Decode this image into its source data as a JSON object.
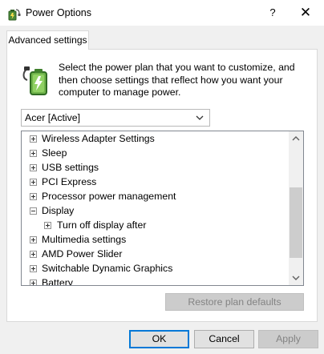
{
  "window": {
    "title": "Power Options",
    "help_glyph": "?",
    "close_glyph": "✕"
  },
  "tabs": [
    {
      "label": "Advanced settings",
      "active": true
    }
  ],
  "description": "Select the power plan that you want to customize, and then choose settings that reflect how you want your computer to manage power.",
  "plan_select": {
    "value": "Acer [Active]"
  },
  "tree": {
    "items": [
      {
        "label": "Wireless Adapter Settings",
        "expander": "plus",
        "level": 0
      },
      {
        "label": "Sleep",
        "expander": "plus",
        "level": 0
      },
      {
        "label": "USB settings",
        "expander": "plus",
        "level": 0
      },
      {
        "label": "PCI Express",
        "expander": "plus",
        "level": 0
      },
      {
        "label": "Processor power management",
        "expander": "plus",
        "level": 0
      },
      {
        "label": "Display",
        "expander": "minus",
        "level": 0
      },
      {
        "label": "Turn off display after",
        "expander": "plus",
        "level": 1
      },
      {
        "label": "Multimedia settings",
        "expander": "plus",
        "level": 0
      },
      {
        "label": "AMD Power Slider",
        "expander": "plus",
        "level": 0
      },
      {
        "label": "Switchable Dynamic Graphics",
        "expander": "plus",
        "level": 0
      },
      {
        "label": "Battery",
        "expander": "plus",
        "level": 0
      }
    ]
  },
  "buttons": {
    "restore": {
      "label": "Restore plan defaults",
      "enabled": false
    },
    "ok": {
      "label": "OK",
      "enabled": true
    },
    "cancel": {
      "label": "Cancel",
      "enabled": true
    },
    "apply": {
      "label": "Apply",
      "enabled": false
    }
  },
  "colors": {
    "accent": "#0078d7",
    "window_bg": "#f0f0f0",
    "disabled_text": "#838383"
  },
  "icons": {
    "title": "power-options-icon",
    "description": "battery-plug-icon"
  }
}
